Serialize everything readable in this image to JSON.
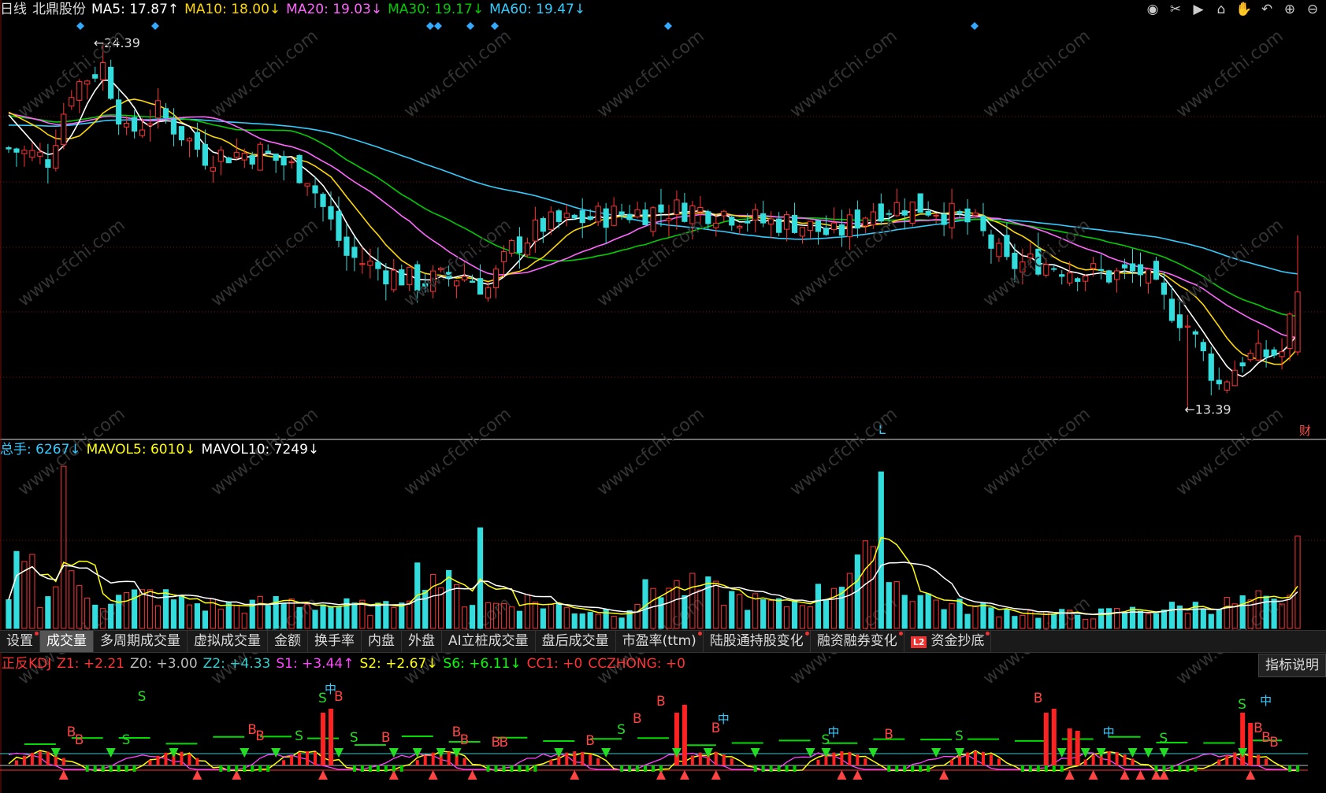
{
  "header": {
    "period": "日线",
    "stock": "北鼎股份",
    "ma": [
      {
        "label": "MA5: 17.87↑",
        "color": "#ffffff"
      },
      {
        "label": "MA10: 18.00↓",
        "color": "#ffd700"
      },
      {
        "label": "MA20: 19.03↓",
        "color": "#ff66ff"
      },
      {
        "label": "MA30: 19.17↓",
        "color": "#00cc00"
      },
      {
        "label": "MA60: 19.47↓",
        "color": "#33ccff"
      }
    ]
  },
  "toolbar_icons": [
    "eye-icon",
    "scissors-icon",
    "play-icon",
    "lock-icon",
    "hand-icon",
    "undo-icon",
    "zoom-in-icon",
    "zoom-out-icon"
  ],
  "price_labels": {
    "high": "24.39",
    "low": "13.39",
    "marker_L": "L",
    "marker_cai": "财"
  },
  "volume_header": [
    {
      "label": "总手: 6267↓",
      "color": "#33ccff"
    },
    {
      "label": "MAVOL5: 6010↓",
      "color": "#ffff00"
    },
    {
      "label": "MAVOL10: 7249↓",
      "color": "#ffffff"
    }
  ],
  "tabs": [
    {
      "label": "设置",
      "dot": true
    },
    {
      "label": "成交量",
      "active": true
    },
    {
      "label": "多周期成交量"
    },
    {
      "label": "虚拟成交量"
    },
    {
      "label": "金额"
    },
    {
      "label": "换手率"
    },
    {
      "label": "内盘"
    },
    {
      "label": "外盘"
    },
    {
      "label": "AI立桩成交量"
    },
    {
      "label": "盘后成交量"
    },
    {
      "label": "市盈率(ttm)",
      "dot": true
    },
    {
      "label": "陆股通持股变化",
      "dot": true
    },
    {
      "label": "融资融券变化",
      "dot": true
    },
    {
      "label": "资金抄底",
      "dot": true,
      "badge": "L2"
    }
  ],
  "kdj_header": [
    {
      "label": "正反KDJ",
      "color": "#ff3333"
    },
    {
      "label": "Z1: +2.21",
      "color": "#ff3333"
    },
    {
      "label": "Z0: +3.00",
      "color": "#bbbbbb"
    },
    {
      "label": "Z2: +4.33",
      "color": "#33cccc"
    },
    {
      "label": "S1: +3.44↑",
      "color": "#ff44ff"
    },
    {
      "label": "S2: +2.67↓",
      "color": "#ffff00"
    },
    {
      "label": "S6: +6.11↓",
      "color": "#00ff00"
    },
    {
      "label": "CC1: +0",
      "color": "#ff3333"
    },
    {
      "label": "CCZHONG: +0",
      "color": "#ff3333"
    }
  ],
  "explain_button": "指标说明",
  "colors": {
    "up": "#ff3333",
    "down": "#33dddd",
    "ma5": "#ffffff",
    "ma10": "#ffd700",
    "ma20": "#ff66ff",
    "ma30": "#00cc00",
    "ma60": "#33ccff",
    "grid": "#7a1010"
  },
  "chart_data": {
    "type": "candlestick",
    "price_range": [
      13.39,
      24.39
    ],
    "close_anchors": [
      [
        0,
        21.2
      ],
      [
        5,
        20.9
      ],
      [
        8,
        23.0
      ],
      [
        12,
        23.7
      ],
      [
        15,
        21.6
      ],
      [
        19,
        22.3
      ],
      [
        25,
        21.0
      ],
      [
        32,
        21.1
      ],
      [
        38,
        20.4
      ],
      [
        43,
        18.0
      ],
      [
        48,
        17.5
      ],
      [
        52,
        17.2
      ],
      [
        58,
        17.4
      ],
      [
        61,
        17.0
      ],
      [
        64,
        18.2
      ],
      [
        68,
        18.9
      ],
      [
        71,
        19.0
      ],
      [
        76,
        19.2
      ],
      [
        80,
        19.3
      ],
      [
        86,
        19.4
      ],
      [
        91,
        19.3
      ],
      [
        96,
        19.0
      ],
      [
        100,
        19.0
      ],
      [
        105,
        18.6
      ],
      [
        110,
        19.4
      ],
      [
        114,
        19.5
      ],
      [
        118,
        19.4
      ],
      [
        123,
        18.9
      ],
      [
        127,
        17.7
      ],
      [
        131,
        17.8
      ],
      [
        135,
        17.6
      ],
      [
        140,
        17.4
      ],
      [
        144,
        17.5
      ],
      [
        147,
        16.6
      ],
      [
        150,
        15.9
      ],
      [
        154,
        14.1
      ],
      [
        157,
        14.9
      ],
      [
        162,
        15.1
      ],
      [
        164,
        16.9
      ]
    ],
    "volume_range": [
      0,
      30000
    ],
    "volume_anchors": [
      [
        0,
        4500
      ],
      [
        2,
        16000
      ],
      [
        4,
        6000
      ],
      [
        8,
        8000
      ],
      [
        12,
        5000
      ],
      [
        18,
        6000
      ],
      [
        24,
        4200
      ],
      [
        30,
        4000
      ],
      [
        36,
        4800
      ],
      [
        42,
        4000
      ],
      [
        48,
        3500
      ],
      [
        53,
        11000
      ],
      [
        57,
        6500
      ],
      [
        60,
        4000
      ],
      [
        66,
        5000
      ],
      [
        72,
        3300
      ],
      [
        78,
        3000
      ],
      [
        82,
        7500
      ],
      [
        88,
        7000
      ],
      [
        94,
        5000
      ],
      [
        98,
        4000
      ],
      [
        104,
        6500
      ],
      [
        108,
        13000
      ],
      [
        111,
        9500
      ],
      [
        116,
        6000
      ],
      [
        120,
        4000
      ],
      [
        126,
        3300
      ],
      [
        132,
        2500
      ],
      [
        138,
        2500
      ],
      [
        144,
        3200
      ],
      [
        150,
        3800
      ],
      [
        155,
        4300
      ],
      [
        159,
        5000
      ],
      [
        162,
        3500
      ],
      [
        164,
        6267
      ]
    ],
    "count": 165
  }
}
